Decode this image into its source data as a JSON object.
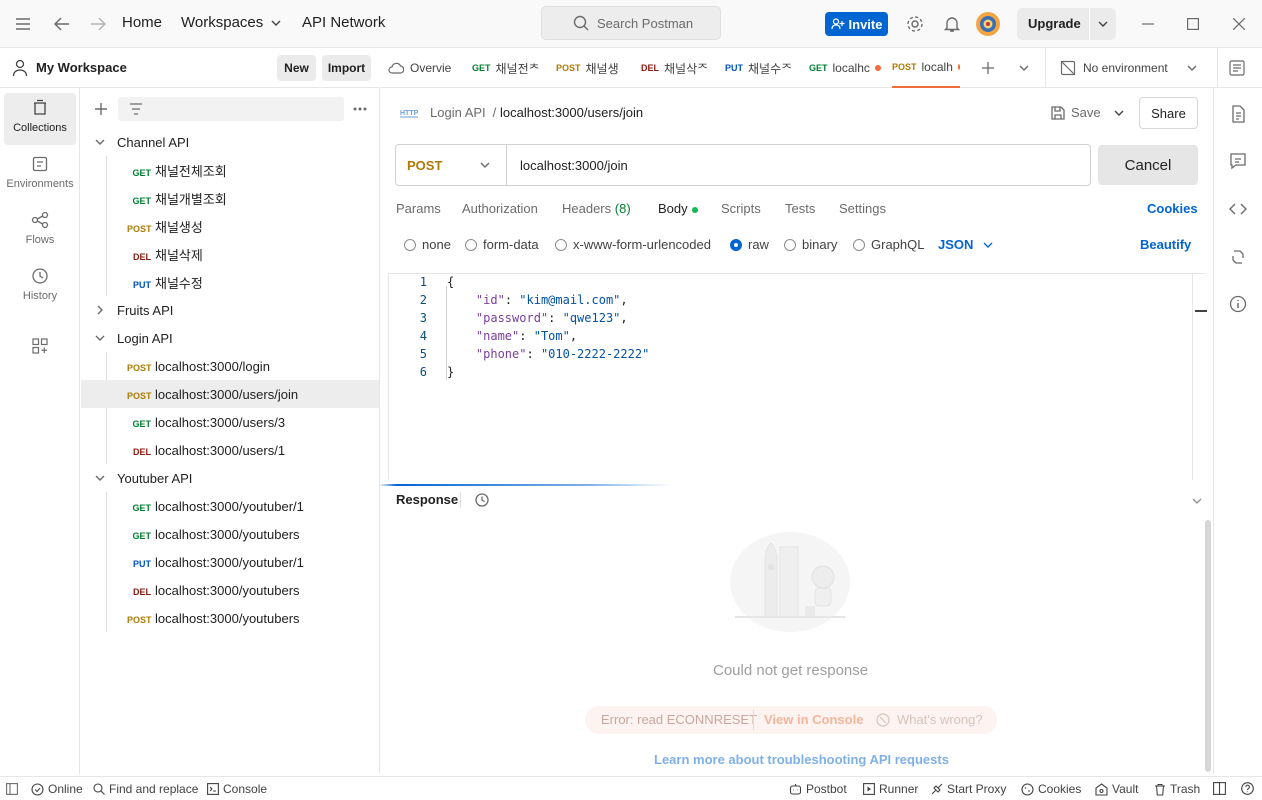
{
  "titlebar": {
    "nav": [
      "Home",
      "Workspaces",
      "API Network"
    ],
    "search_placeholder": "Search Postman",
    "invite_label": "Invite",
    "upgrade_label": "Upgrade"
  },
  "workspace": {
    "title": "My Workspace",
    "new_label": "New",
    "import_label": "Import"
  },
  "rail": [
    "Collections",
    "Environments",
    "Flows",
    "History"
  ],
  "tree": [
    {
      "type": "folder",
      "label": "Channel API",
      "expanded": true
    },
    {
      "type": "request",
      "method": "GET",
      "label": "채널전체조회"
    },
    {
      "type": "request",
      "method": "GET",
      "label": "채널개별조회"
    },
    {
      "type": "request",
      "method": "POST",
      "label": "채널생성"
    },
    {
      "type": "request",
      "method": "DEL",
      "label": "채널삭제"
    },
    {
      "type": "request",
      "method": "PUT",
      "label": "채널수정"
    },
    {
      "type": "folder",
      "label": "Fruits API",
      "expanded": false
    },
    {
      "type": "folder",
      "label": "Login API",
      "expanded": true
    },
    {
      "type": "request",
      "method": "POST",
      "label": "localhost:3000/login"
    },
    {
      "type": "request",
      "method": "POST",
      "label": "localhost:3000/users/join",
      "selected": true
    },
    {
      "type": "request",
      "method": "GET",
      "label": "localhost:3000/users/3"
    },
    {
      "type": "request",
      "method": "DEL",
      "label": "localhost:3000/users/1"
    },
    {
      "type": "folder",
      "label": "Youtuber API",
      "expanded": true
    },
    {
      "type": "request",
      "method": "GET",
      "label": "localhost:3000/youtuber/1"
    },
    {
      "type": "request",
      "method": "GET",
      "label": "localhost:3000/youtubers"
    },
    {
      "type": "request",
      "method": "PUT",
      "label": "localhost:3000/youtuber/1"
    },
    {
      "type": "request",
      "method": "DEL",
      "label": "localhost:3000/youtubers"
    },
    {
      "type": "request",
      "method": "POST",
      "label": "localhost:3000/youtubers"
    }
  ],
  "tabs": [
    {
      "method": "",
      "label": "Overvie"
    },
    {
      "method": "GET",
      "label": "채널전ᄎ"
    },
    {
      "method": "POST",
      "label": "채널생"
    },
    {
      "method": "DEL",
      "label": "채널삭ᄌ"
    },
    {
      "method": "PUT",
      "label": "채널수ᄌ"
    },
    {
      "method": "GET",
      "label": "localhc",
      "dot": true
    },
    {
      "method": "POST",
      "label": "localh",
      "dot": true,
      "active": true
    }
  ],
  "environment": "No environment",
  "request": {
    "breadcrumb_parent": "Login API",
    "breadcrumb_sep": "/",
    "breadcrumb_current": "localhost:3000/users/join",
    "save_label": "Save",
    "share_label": "Share",
    "method": "POST",
    "url": "localhost:3000/join",
    "cancel_label": "Cancel",
    "tabs": [
      "Params",
      "Authorization",
      "Headers",
      "Body",
      "Scripts",
      "Tests",
      "Settings"
    ],
    "headers_count": "(8)",
    "cookies_label": "Cookies",
    "body_modes": [
      "none",
      "form-data",
      "x-www-form-urlencoded",
      "raw",
      "binary",
      "GraphQL"
    ],
    "body_mode_selected": "raw",
    "format": "JSON",
    "beautify_label": "Beautify",
    "code_lines": [
      {
        "n": "1",
        "text": "{"
      },
      {
        "n": "2",
        "key": "\"id\"",
        "value": "\"kim@mail.com\"",
        "comma": true
      },
      {
        "n": "3",
        "key": "\"password\"",
        "value": "\"qwe123\"",
        "comma": true
      },
      {
        "n": "4",
        "key": "\"name\"",
        "value": "\"Tom\"",
        "comma": true
      },
      {
        "n": "5",
        "key": "\"phone\"",
        "value": "\"010-2222-2222\"",
        "comma": false
      },
      {
        "n": "6",
        "text": "}"
      }
    ]
  },
  "response": {
    "title": "Response",
    "message": "Could not get response",
    "error": "Error: read ECONNRESET",
    "view_console": "View in Console",
    "whats_wrong": "What's wrong?",
    "learn_more": "Learn more about troubleshooting API requests"
  },
  "statusbar": {
    "online": "Online",
    "find_replace": "Find and replace",
    "console": "Console",
    "postbot": "Postbot",
    "runner": "Runner",
    "start_proxy": "Start Proxy",
    "cookies": "Cookies",
    "vault": "Vault",
    "trash": "Trash"
  },
  "colors": {
    "accent": "#0265d2",
    "tab_active": "#f26b3a",
    "get": "#007f31",
    "post": "#ad7a03",
    "del": "#8e1a10",
    "put": "#0053b8"
  }
}
